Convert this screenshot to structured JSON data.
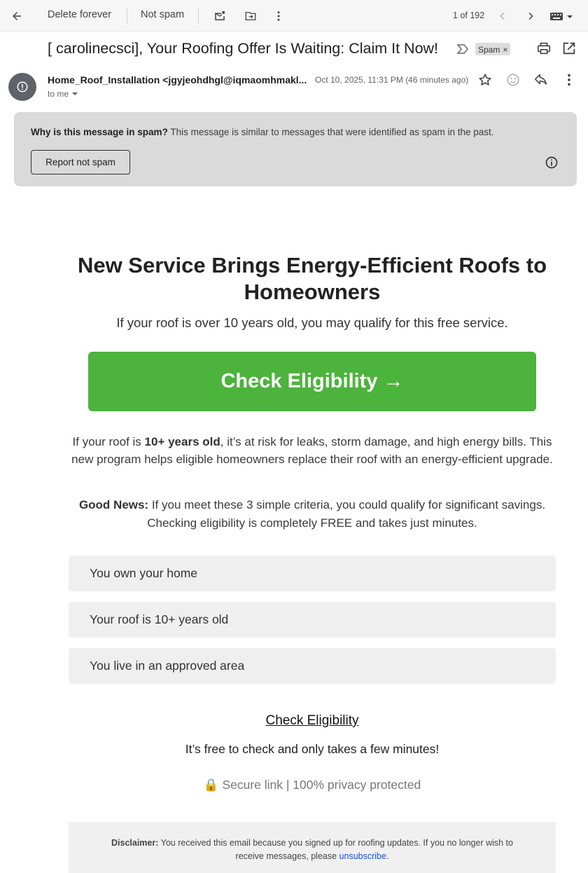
{
  "toolbar": {
    "delete_label": "Delete forever",
    "not_spam_label": "Not spam",
    "count": "1 of 192"
  },
  "email": {
    "subject": "[ carolinecsci], Your Roofing Offer Is Waiting: Claim It Now!",
    "label": "Spam",
    "sender_name": "Home_Roof_Installation",
    "sender_email": "<jgyjeohdhgl@iqmaomhmakl...",
    "to": "to me",
    "date": "Oct 10, 2025, 11:31 PM (46 minutes ago)"
  },
  "spam_banner": {
    "question": "Why is this message in spam?",
    "explanation": "This message is similar to messages that were identified as spam in the past.",
    "report_label": "Report not spam"
  },
  "body": {
    "headline": "New Service Brings Energy-Efficient Roofs to Homeowners",
    "subhead": "If your roof is over 10 years old, you may qualify for this free service.",
    "cta_label": "Check Eligibility →",
    "para1_pre": "If your roof is ",
    "para1_bold": "10+ years old",
    "para1_post": ", it’s at risk for leaks, storm damage, and high energy bills. This new program helps eligible homeowners replace their roof with an energy-efficient upgrade.",
    "para2_bold": "Good News:",
    "para2_text": " If you meet these 3 simple criteria, you could qualify for significant savings. Checking eligibility is completely FREE and takes just minutes.",
    "criteria": [
      "You own your home",
      "Your roof is 10+ years old",
      "You live in an approved area"
    ],
    "check_link": "Check Eligibility",
    "free_text": "It’s free to check and only takes a few minutes!",
    "secure_text": "🔒 Secure link | 100% privacy protected",
    "disclaimer_bold": "Disclaimer:",
    "disclaimer_text": " You received this email because you signed up for roofing updates. If you no longer wish to receive messages, please ",
    "unsubscribe_label": "unsubscribe",
    "disclaimer_end": "."
  },
  "colors": {
    "cta_green": "#4cb33d",
    "spam_banner": "#dadada",
    "link_blue": "#1a4fd6"
  },
  "icons": {
    "back": "arrow-left-icon",
    "mark_unread": "mail-unread-icon",
    "move_to": "folder-move-icon",
    "more": "more-vert-icon",
    "prev": "chevron-left-icon",
    "next": "chevron-right-icon",
    "keyboard": "keyboard-icon",
    "print": "print-icon",
    "popout": "open-new-window-icon",
    "star": "star-icon",
    "emoji": "emoji-icon",
    "reply": "reply-icon"
  }
}
